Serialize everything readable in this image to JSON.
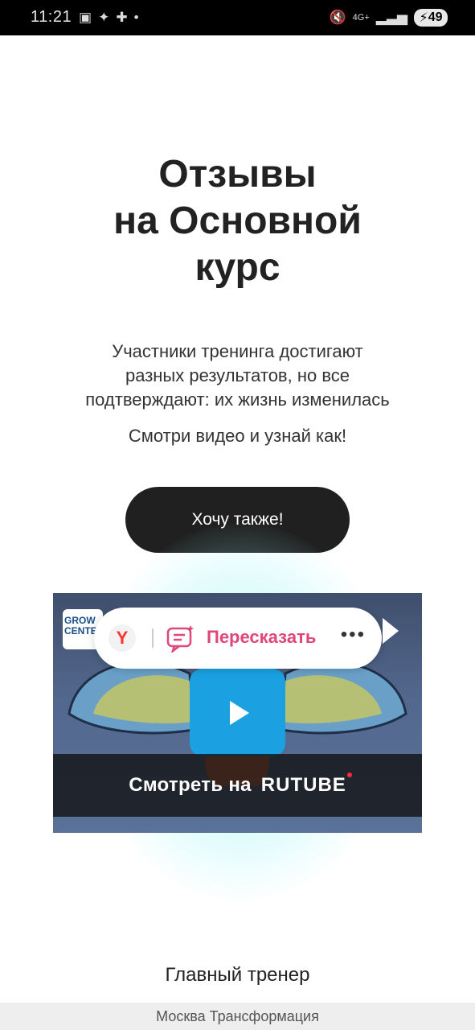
{
  "status_bar": {
    "time": "11:21",
    "network": "4G+",
    "battery": "49"
  },
  "main": {
    "title_lines": [
      "Отзывы",
      "на Основной",
      "курс"
    ],
    "subtitle_lines": [
      "Участники тренинга достигают",
      "разных результатов, но все",
      "подтверждают: их жизнь изменилась"
    ],
    "subtitle2": "Смотри видео и узнай как!",
    "cta_label": "Хочу также!"
  },
  "video": {
    "channel_logo": [
      "GROW",
      "CENTER"
    ],
    "watch_on": "Смотреть на",
    "rutube": "RUTUBE"
  },
  "yandex_overlay": {
    "retell_label": "Пересказать",
    "more": "•••"
  },
  "section": {
    "trainer_heading": "Главный тренер"
  },
  "footer": {
    "text": "Москва Трансформация"
  }
}
